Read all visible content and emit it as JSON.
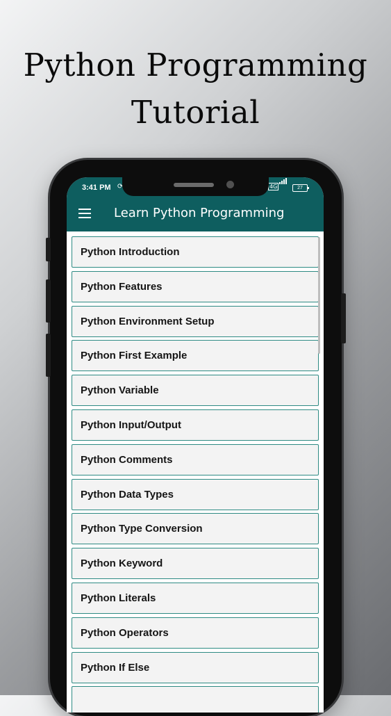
{
  "promo": {
    "title_line1": "Python Programming",
    "title_line2": "Tutorial"
  },
  "status_bar": {
    "time": "3:41 PM",
    "battery": "27",
    "sync_icon": "sync-icon",
    "volte_icon": "volte-icon"
  },
  "app_bar": {
    "menu_icon": "hamburger-menu-icon",
    "title": "Learn Python Programming",
    "color": "#0e5e5f"
  },
  "topics": [
    "Python Introduction",
    "Python Features",
    "Python Environment Setup",
    "Python First Example",
    "Python Variable",
    "Python Input/Output",
    "Python Comments",
    "Python Data Types",
    "Python Type Conversion",
    "Python Keyword",
    "Python Literals",
    "Python Operators",
    "Python If Else"
  ],
  "colors": {
    "accent": "#0e5e5f",
    "item_border": "#2d8a83",
    "item_background": "#f3f3f3"
  }
}
